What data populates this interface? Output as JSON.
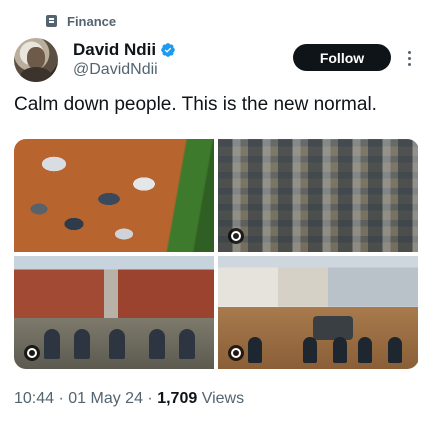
{
  "context": {
    "label": "Finance",
    "icon": "community-icon"
  },
  "author": {
    "display_name": "David Ndii",
    "handle": "@DavidNdii",
    "verified": true,
    "verified_color": "#1d9bf0"
  },
  "actions": {
    "follow_label": "Follow",
    "more_icon": "more-options-icon"
  },
  "tweet": {
    "text": "Calm down people. This is the new normal."
  },
  "media": {
    "photos": [
      {
        "alt_icon": "alt-badge-icon"
      },
      {
        "alt_icon": "alt-badge-icon"
      },
      {
        "alt_icon": "alt-badge-icon"
      },
      {
        "alt_icon": "alt-badge-icon"
      }
    ]
  },
  "meta": {
    "time": "10:44",
    "sep1": " · ",
    "date": "01 May 24",
    "sep2": " · ",
    "views_count": "1,709",
    "views_label": " Views"
  },
  "colors": {
    "text_primary": "#0f1419",
    "text_secondary": "#536471",
    "button_bg": "#0f1419"
  }
}
